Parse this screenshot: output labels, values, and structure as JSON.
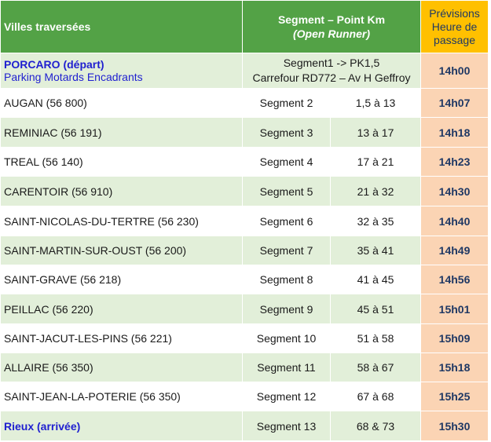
{
  "header": {
    "city": "Villes traversées",
    "segment_line1": "Segment – Point Km",
    "segment_line2": "(Open Runner)",
    "time_line1": "Prévisions",
    "time_line2": "Heure de",
    "time_line3": "passage"
  },
  "first_row": {
    "city_line1": "PORCARO (départ)",
    "city_line2": "Parking Motards Encadrants",
    "segment_line1": "Segment1 -> PK1,5",
    "segment_line2": "Carrefour RD772 – Av H Geffroy",
    "time": "14h00"
  },
  "rows": [
    {
      "city": "AUGAN (56 800)",
      "segment": "Segment 2",
      "km": "1,5 à 13",
      "time": "14h07"
    },
    {
      "city": "REMINIAC (56 191)",
      "segment": "Segment 3",
      "km": "13 à 17",
      "time": "14h18"
    },
    {
      "city": "TREAL (56 140)",
      "segment": "Segment 4",
      "km": "17 à 21",
      "time": "14h23"
    },
    {
      "city": "CARENTOIR (56 910)",
      "segment": "Segment 5",
      "km": "21 à 32",
      "time": "14h30"
    },
    {
      "city": "SAINT-NICOLAS-DU-TERTRE (56 230)",
      "segment": "Segment 6",
      "km": "32 à 35",
      "time": "14h40"
    },
    {
      "city": "SAINT-MARTIN-SUR-OUST (56 200)",
      "segment": "Segment 7",
      "km": "35 à 41",
      "time": "14h49"
    },
    {
      "city": "SAINT-GRAVE (56 218)",
      "segment": "Segment 8",
      "km": "41 à 45",
      "time": "14h56"
    },
    {
      "city": "PEILLAC (56 220)",
      "segment": "Segment 9",
      "km": "45 à 51",
      "time": "15h01"
    },
    {
      "city": "SAINT-JACUT-LES-PINS (56 221)",
      "segment": "Segment 10",
      "km": "51 à 58",
      "time": "15h09"
    },
    {
      "city": "ALLAIRE (56 350)",
      "segment": "Segment 11",
      "km": "58 à 67",
      "time": "15h18"
    },
    {
      "city": "SAINT-JEAN-LA-POTERIE (56 350)",
      "segment": "Segment 12",
      "km": "67 à 68",
      "time": "15h25"
    },
    {
      "city": "Rieux (arrivée)",
      "segment": "Segment 13",
      "km": "68 & 73",
      "time": "15h30"
    }
  ],
  "colors": {
    "header_green": "#53a246",
    "header_orange": "#ffc000",
    "row_green": "#e2efd9",
    "time_cell": "#fbd4b4",
    "highlight_blue": "#1f1fd0"
  }
}
